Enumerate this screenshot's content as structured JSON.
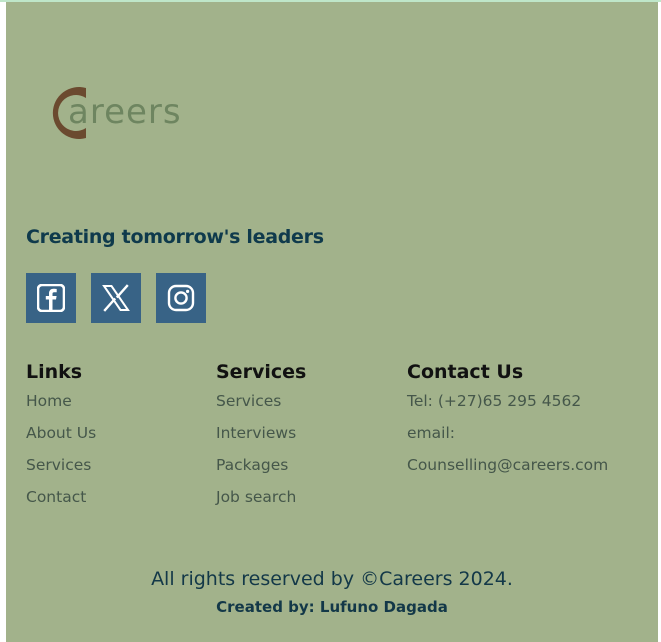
{
  "brand": {
    "logo_text": "areers",
    "logo_initial_color": "#6b4a2f",
    "logo_text_color": "#6e8560"
  },
  "footer": {
    "background": "#a2b28b",
    "tagline": "Creating tomorrow's leaders",
    "socials": [
      {
        "name": "facebook",
        "icon": "facebook-icon"
      },
      {
        "name": "x",
        "icon": "x-twitter-icon"
      },
      {
        "name": "instagram",
        "icon": "instagram-icon"
      }
    ],
    "social_button_color": "#386386",
    "links": {
      "title": "Links",
      "items": [
        "Home",
        "About Us",
        "Services",
        "Contact"
      ]
    },
    "services": {
      "title": "Services",
      "items": [
        "Services",
        "Interviews",
        "Packages",
        "Job search"
      ]
    },
    "contact": {
      "title": "Contact Us",
      "items": [
        "Tel: (+27)65 295 4562",
        "email:",
        "Counselling@careers.com"
      ]
    },
    "copyright": "All rights reserved by ©Careers 2024.",
    "credit": "Created by: Lufuno Dagada"
  }
}
